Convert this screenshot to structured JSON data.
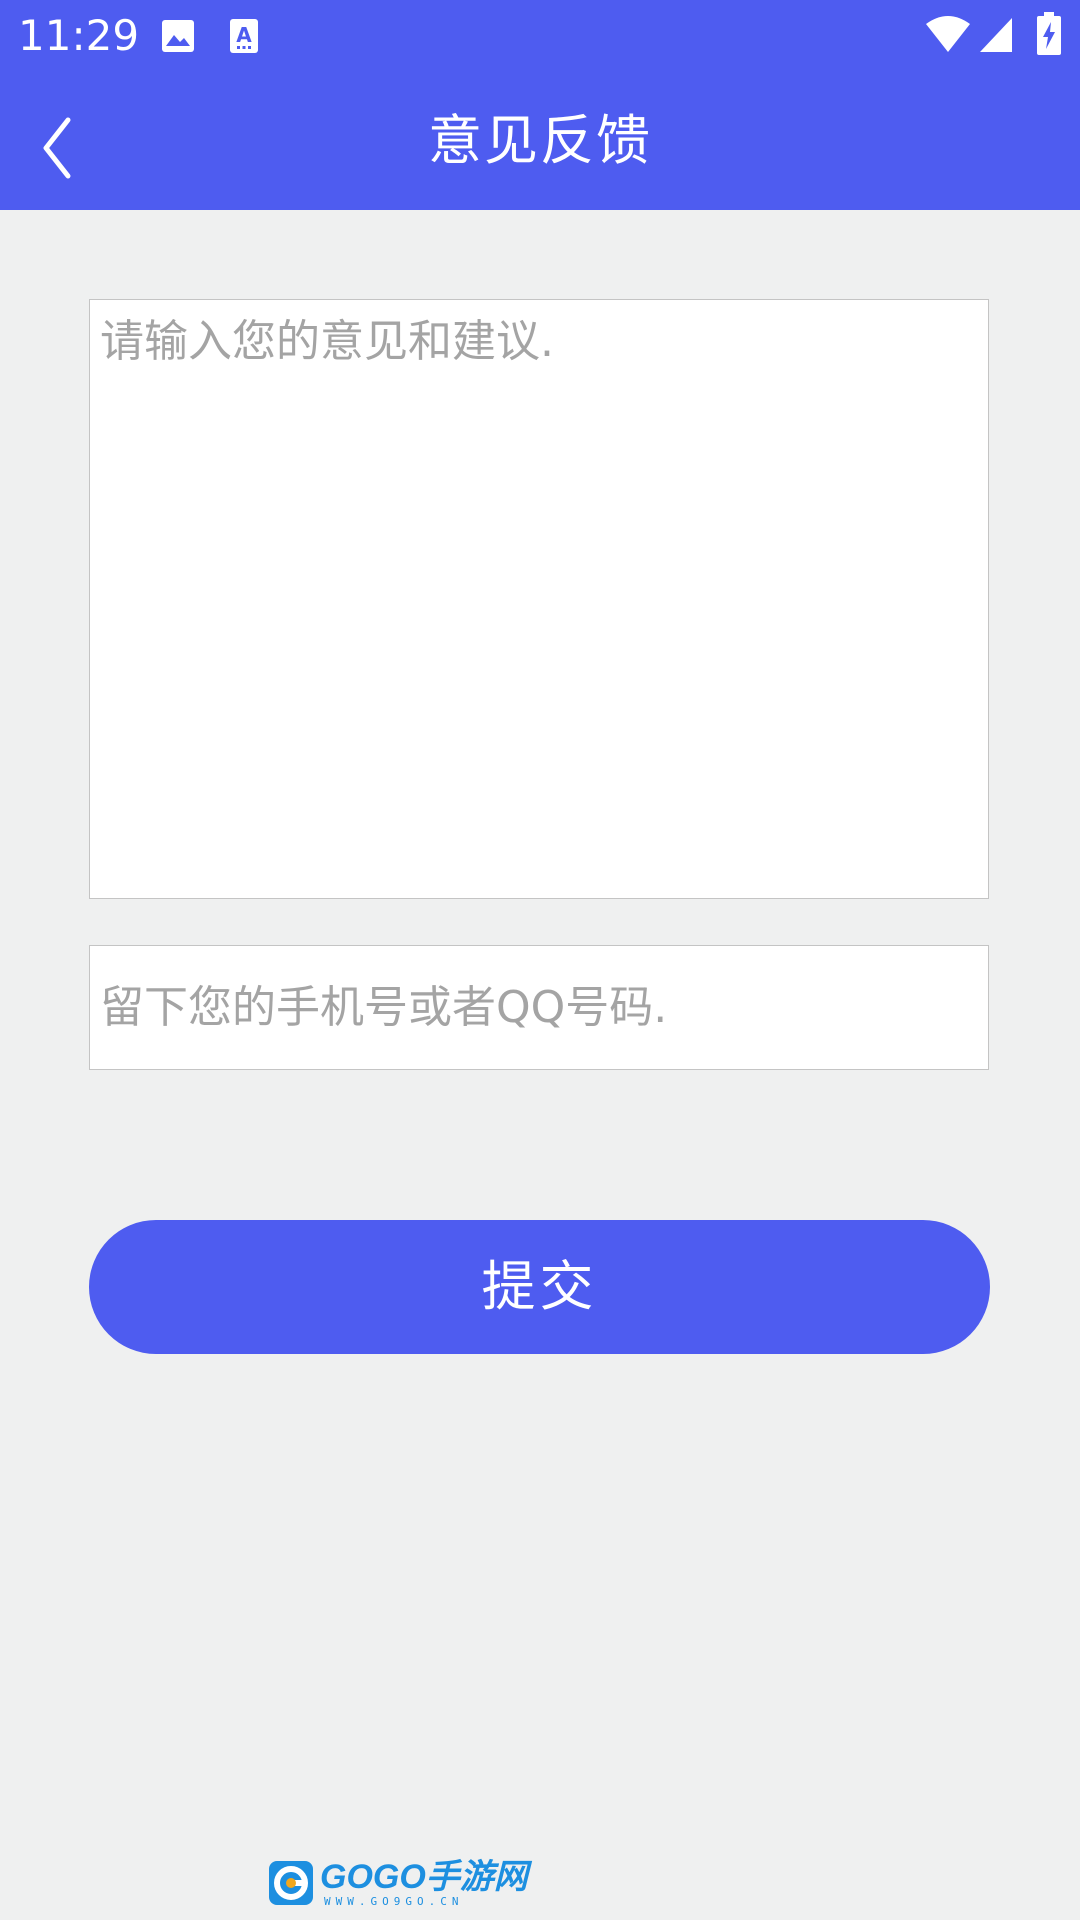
{
  "status_bar": {
    "time": "11:29",
    "icons": [
      "image-icon",
      "text-a-icon",
      "wifi-icon",
      "signal-icon",
      "battery-charging-icon"
    ]
  },
  "toolbar": {
    "back_icon": "chevron-left-icon",
    "title": "意见反馈"
  },
  "form": {
    "feedback_placeholder": "请输入您的意见和建议.",
    "feedback_value": "",
    "contact_placeholder": "留下您的手机号或者QQ号码.",
    "contact_value": "",
    "submit_label": "提交"
  },
  "footer": {
    "brand_name": "GOGO手游网",
    "brand_url": "WWW.GO9GO.CN"
  },
  "colors": {
    "primary": "#4e5cf0",
    "background": "#eff0f0",
    "border": "#c4c4c4",
    "placeholder": "#a4a4a4",
    "brand": "#1d8fe0"
  }
}
